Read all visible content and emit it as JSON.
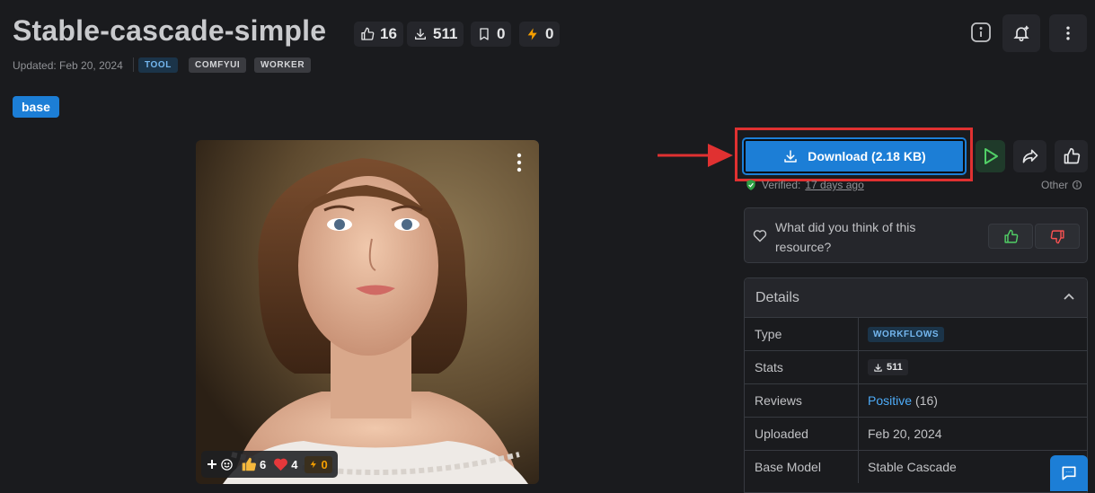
{
  "header": {
    "title": "Stable-cascade-simple",
    "stats": {
      "likes": "16",
      "downloads": "511",
      "bookmarks": "0",
      "buzz": "0"
    },
    "updated": "Updated: Feb 20, 2024",
    "tags": [
      "TOOL",
      "COMFYUI",
      "WORKER"
    ],
    "icons": [
      "info-icon",
      "bell-plus-icon",
      "more-vertical-icon"
    ]
  },
  "base_badge": "base",
  "preview": {
    "reactions": {
      "thumbs": "6",
      "heart": "4",
      "buzz": "0"
    }
  },
  "actions": {
    "download_label": "Download (2.18 KB)",
    "verified_prefix": "Verified:",
    "verified_time": "17 days ago",
    "other_label": "Other"
  },
  "feedback": {
    "question": "What did you think of this resource?"
  },
  "details": {
    "heading": "Details",
    "rows": {
      "type": {
        "key": "Type",
        "value": "WORKFLOWS"
      },
      "stats": {
        "key": "Stats",
        "value": "511"
      },
      "reviews": {
        "key": "Reviews",
        "positive": "Positive",
        "count": "(16)"
      },
      "uploaded": {
        "key": "Uploaded",
        "value": "Feb 20, 2024"
      },
      "base_model": {
        "key": "Base Model",
        "value": "Stable Cascade"
      }
    }
  },
  "colors": {
    "accent": "#1c7ed6",
    "annotation": "#e03131",
    "bg": "#1a1b1e"
  }
}
